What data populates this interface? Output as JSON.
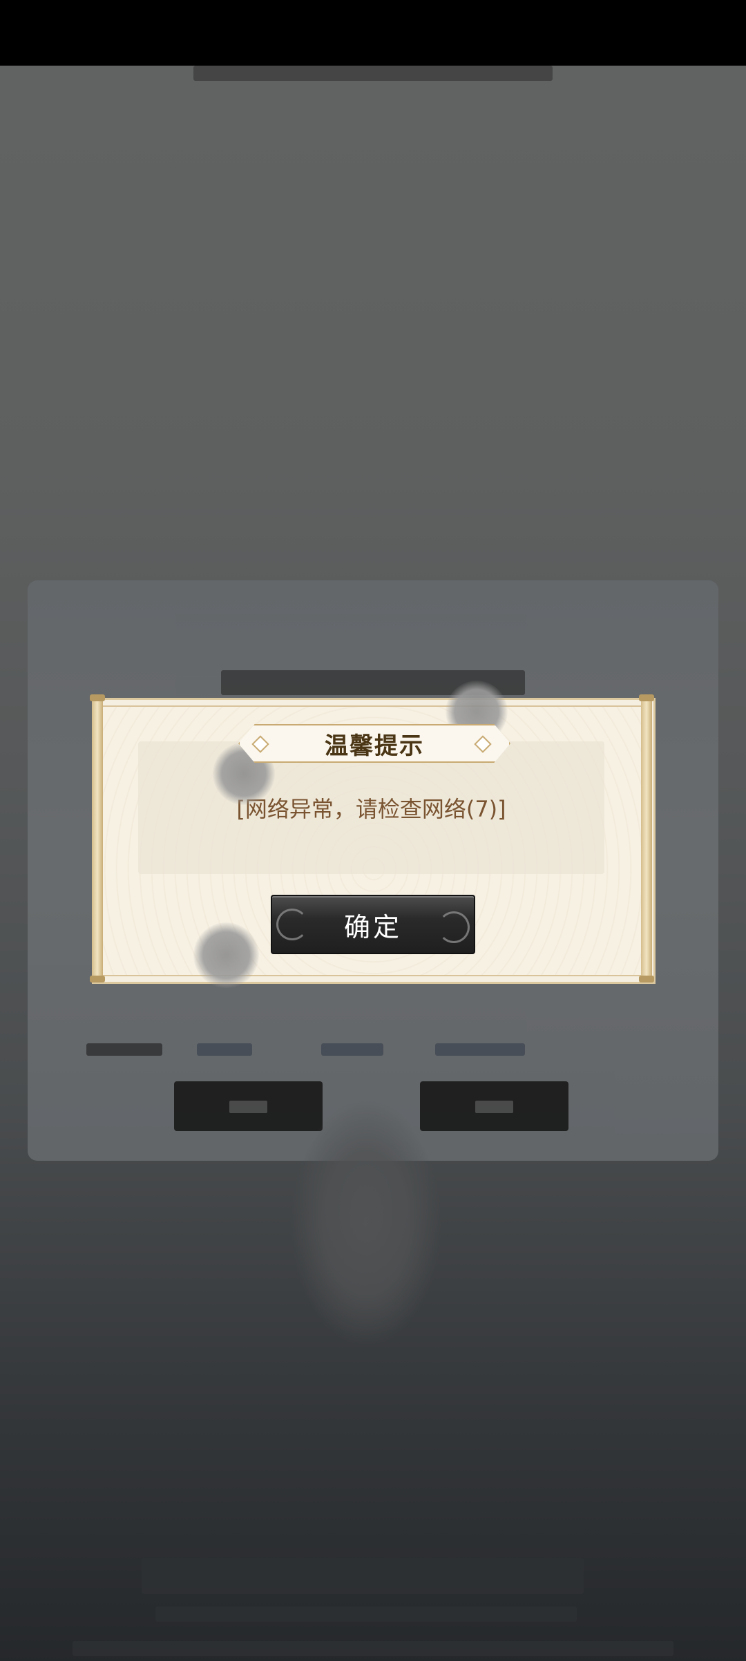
{
  "dialog": {
    "title": "温馨提示",
    "message": "[网络异常，请检查网络(7)]",
    "confirm_label": "确定"
  },
  "colors": {
    "dialog_bg": "#f7f1e4",
    "title_text": "#4a3514",
    "message_text": "#7a5431",
    "button_bg": "#2a2a2a",
    "button_text": "#ffffff"
  }
}
